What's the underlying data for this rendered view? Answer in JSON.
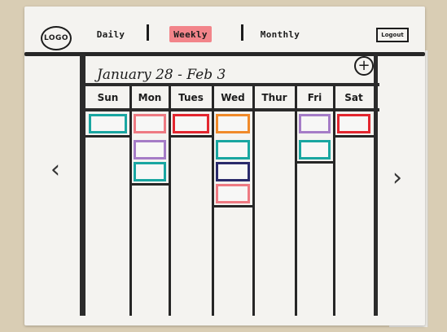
{
  "header": {
    "logo": "LOGO",
    "tabs": [
      {
        "label": "Daily"
      },
      {
        "label": "Weekly",
        "active": true
      },
      {
        "label": "Monthly"
      }
    ],
    "logout": "Logout"
  },
  "calendar": {
    "range_title": "January 28 - Feb 3",
    "add_icon": "plus-circle-icon",
    "days": [
      "Sun",
      "Mon",
      "Tues",
      "Wed",
      "Thur",
      "Fri",
      "Sat"
    ],
    "events": [
      {
        "day": "Sun",
        "slot": 1,
        "color": "teal"
      },
      {
        "day": "Mon",
        "slot": 1,
        "color": "pink"
      },
      {
        "day": "Mon",
        "slot": 2,
        "color": "purple"
      },
      {
        "day": "Mon",
        "slot": 3,
        "color": "teal"
      },
      {
        "day": "Tues",
        "slot": 1,
        "color": "red"
      },
      {
        "day": "Wed",
        "slot": 1,
        "color": "orange"
      },
      {
        "day": "Wed",
        "slot": 2,
        "color": "teal"
      },
      {
        "day": "Wed",
        "slot": 3,
        "color": "navy"
      },
      {
        "day": "Wed",
        "slot": 4,
        "color": "pink"
      },
      {
        "day": "Fri",
        "slot": 1,
        "color": "purple"
      },
      {
        "day": "Fri",
        "slot": 2,
        "color": "teal"
      },
      {
        "day": "Sat",
        "slot": 1,
        "color": "red"
      }
    ]
  },
  "navigation": {
    "prev_icon": "chevron-left-icon",
    "next_icon": "chevron-right-icon"
  },
  "colors": {
    "teal": "#19a6a1",
    "pink": "#ee7a82",
    "red": "#e3262f",
    "orange": "#f08a2a",
    "purple": "#a57cc7",
    "navy": "#2a2a6b",
    "active_tab": "#f2848a"
  }
}
